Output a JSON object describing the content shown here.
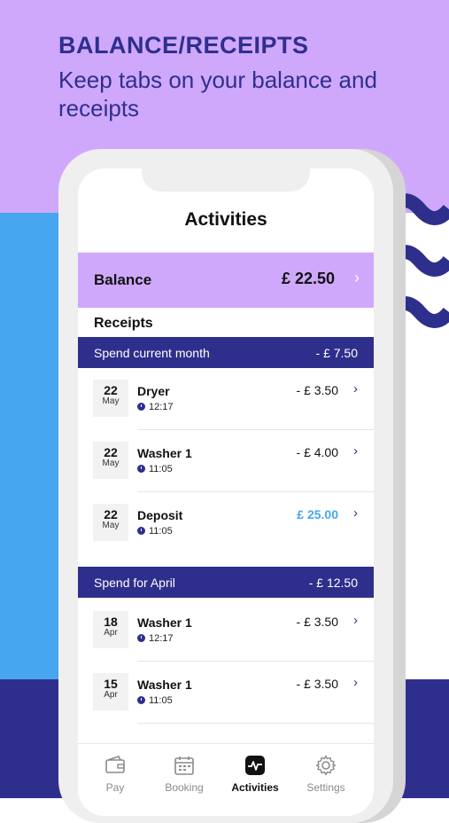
{
  "promo": {
    "headline": "BALANCE/RECEIPTS",
    "subline": "Keep tabs on your balance and receipts"
  },
  "app": {
    "title": "Activities",
    "balance": {
      "label": "Balance",
      "amount": "£ 22.50"
    },
    "receipts_label": "Receipts",
    "months": [
      {
        "label": "Spend current month",
        "total": "- £ 7.50",
        "rows": [
          {
            "day": "22",
            "month": "May",
            "title": "Dryer",
            "time": "12:17",
            "amount": "- £ 3.50"
          },
          {
            "day": "22",
            "month": "May",
            "title": "Washer 1",
            "time": "11:05",
            "amount": "- £ 4.00"
          },
          {
            "day": "22",
            "month": "May",
            "title": "Deposit",
            "time": "11:05",
            "amount": "£ 25.00"
          }
        ]
      },
      {
        "label": "Spend for April",
        "total": "- £ 12.50",
        "rows": [
          {
            "day": "18",
            "month": "Apr",
            "title": "Washer 1",
            "time": "12:17",
            "amount": "- £ 3.50"
          },
          {
            "day": "15",
            "month": "Apr",
            "title": "Washer 1",
            "time": "11:05",
            "amount": "- £ 3.50"
          }
        ]
      }
    ],
    "tabs": [
      {
        "label": "Pay",
        "icon": "wallet-icon"
      },
      {
        "label": "Booking",
        "icon": "calendar-icon"
      },
      {
        "label": "Activities",
        "icon": "activity-icon",
        "active": true
      },
      {
        "label": "Settings",
        "icon": "gear-icon"
      }
    ]
  },
  "colors": {
    "lavender": "#cfa8fb",
    "navy": "#2e2f8c",
    "sky": "#46a6ef"
  }
}
